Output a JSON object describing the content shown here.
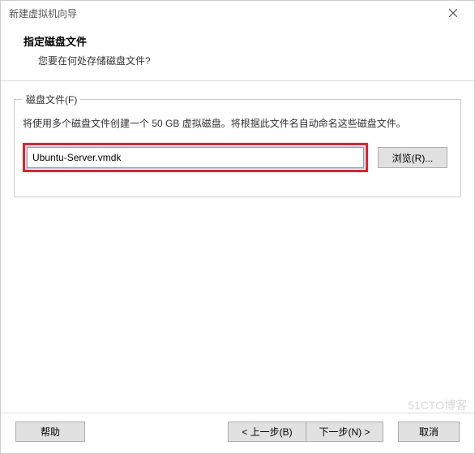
{
  "window": {
    "title": "新建虚拟机向导"
  },
  "header": {
    "title": "指定磁盘文件",
    "subtitle": "您要在何处存储磁盘文件?"
  },
  "fieldset": {
    "legend": "磁盘文件(F)",
    "description": "将使用多个磁盘文件创建一个 50 GB 虚拟磁盘。将根据此文件名自动命名这些磁盘文件。",
    "file_value": "Ubuntu-Server.vmdk",
    "browse_label": "浏览(R)..."
  },
  "buttons": {
    "help": "帮助",
    "back": "< 上一步(B)",
    "next": "下一步(N) >",
    "cancel": "取消"
  },
  "watermark": "51CTO博客"
}
